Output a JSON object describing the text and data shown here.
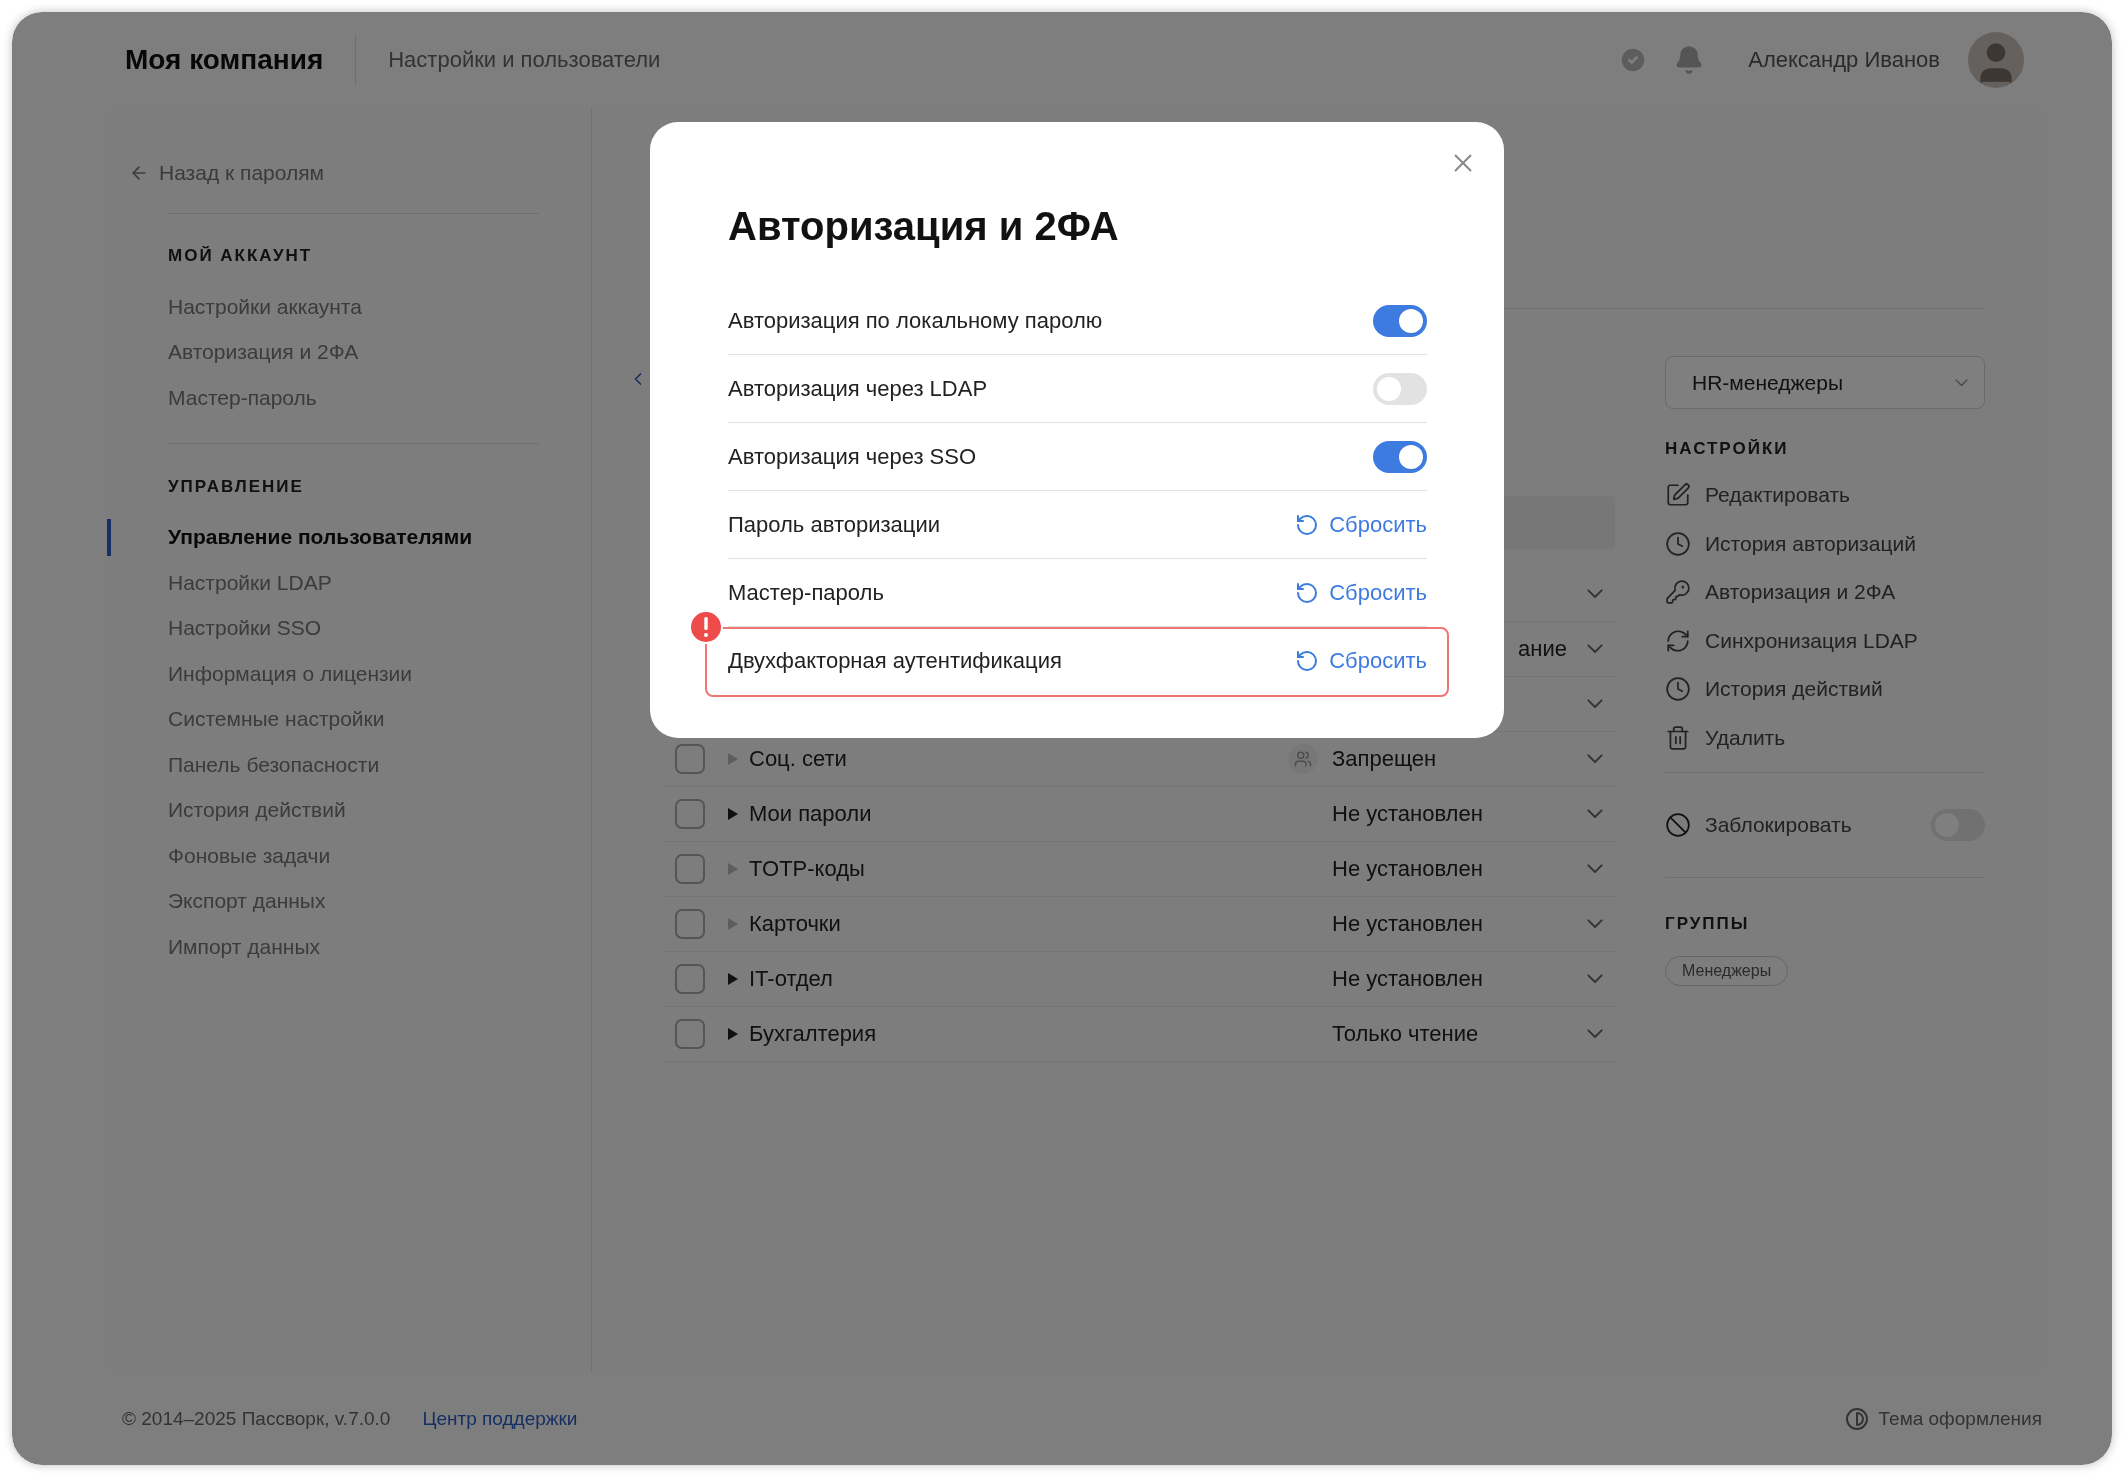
{
  "header": {
    "brand": "Моя компания",
    "section": "Настройки и пользователи",
    "user": "Александр Иванов"
  },
  "sidebar": {
    "back": "Назад к паролям",
    "groups": [
      {
        "title": "МОЙ АККАУНТ",
        "items": [
          {
            "label": "Настройки аккаунта",
            "selected": false
          },
          {
            "label": "Авторизация и 2ФА",
            "selected": false
          },
          {
            "label": "Мастер-пароль",
            "selected": false
          }
        ]
      },
      {
        "title": "УПРАВЛЕНИЕ",
        "items": [
          {
            "label": "Управление пользователями",
            "selected": true
          },
          {
            "label": "Настройки LDAP",
            "selected": false
          },
          {
            "label": "Настройки SSO",
            "selected": false
          },
          {
            "label": "Информация о лицензии",
            "selected": false
          },
          {
            "label": "Системные настройки",
            "selected": false
          },
          {
            "label": "Панель безопасности",
            "selected": false
          },
          {
            "label": "История действий",
            "selected": false
          },
          {
            "label": "Фоновые задачи",
            "selected": false
          },
          {
            "label": "Экспорт данных",
            "selected": false
          },
          {
            "label": "Импорт данных",
            "selected": false
          }
        ]
      }
    ]
  },
  "table": {
    "rows": [
      {
        "kind": "covered"
      },
      {
        "kind": "covered",
        "status": "ание"
      },
      {
        "kind": "covered"
      },
      {
        "kind": "full",
        "name": "Соц. сети",
        "status": "Запрещен",
        "checked": false,
        "expandable": false,
        "group": true
      },
      {
        "kind": "full",
        "name": "Мои пароли",
        "status": "Не установлен",
        "checked": false,
        "expandable": true,
        "group": false
      },
      {
        "kind": "full",
        "name": "TOTP-коды",
        "status": "Не установлен",
        "checked": false,
        "expandable": false,
        "group": false
      },
      {
        "kind": "full",
        "name": "Карточки",
        "status": "Не установлен",
        "checked": false,
        "expandable": false,
        "group": false
      },
      {
        "kind": "full",
        "name": "IT-отдел",
        "status": "Не установлен",
        "checked": false,
        "expandable": true,
        "group": false
      },
      {
        "kind": "full",
        "name": "Бухгалтерия",
        "status": "Только чтение",
        "checked": false,
        "expandable": true,
        "group": false
      }
    ]
  },
  "panel": {
    "dropdown": "HR-менеджеры",
    "settings_title": "НАСТРОЙКИ",
    "actions": [
      {
        "kind": "edit",
        "label": "Редактировать"
      },
      {
        "kind": "history",
        "label": "История авторизаций"
      },
      {
        "kind": "auth",
        "label": "Авторизация и 2ФА"
      },
      {
        "kind": "sync",
        "label": "Синхронизация LDAP"
      },
      {
        "kind": "history",
        "label": "История действий"
      },
      {
        "kind": "delete",
        "label": "Удалить"
      }
    ],
    "block": {
      "label": "Заблокировать",
      "on": false
    },
    "groups_title": "ГРУППЫ",
    "groups": [
      "Менеджеры"
    ]
  },
  "footer": {
    "copyright": "© 2014–2025 Пассворк, v.7.0.0",
    "support": "Центр поддержки",
    "theme": "Тема оформления"
  },
  "modal": {
    "title": "Авторизация и 2ФА",
    "rows": [
      {
        "kind": "toggle",
        "label": "Авторизация по локальному паролю",
        "on": true
      },
      {
        "kind": "toggle",
        "label": "Авторизация через LDAP",
        "on": false
      },
      {
        "kind": "toggle",
        "label": "Авторизация через SSO",
        "on": true
      },
      {
        "kind": "reset",
        "label": "Пароль авторизации",
        "action": "Сбросить",
        "error": false
      },
      {
        "kind": "reset",
        "label": "Мастер-пароль",
        "action": "Сбросить",
        "error": false
      },
      {
        "kind": "reset",
        "label": "Двухфакторная аутентификация",
        "action": "Сбросить",
        "error": true
      }
    ]
  }
}
